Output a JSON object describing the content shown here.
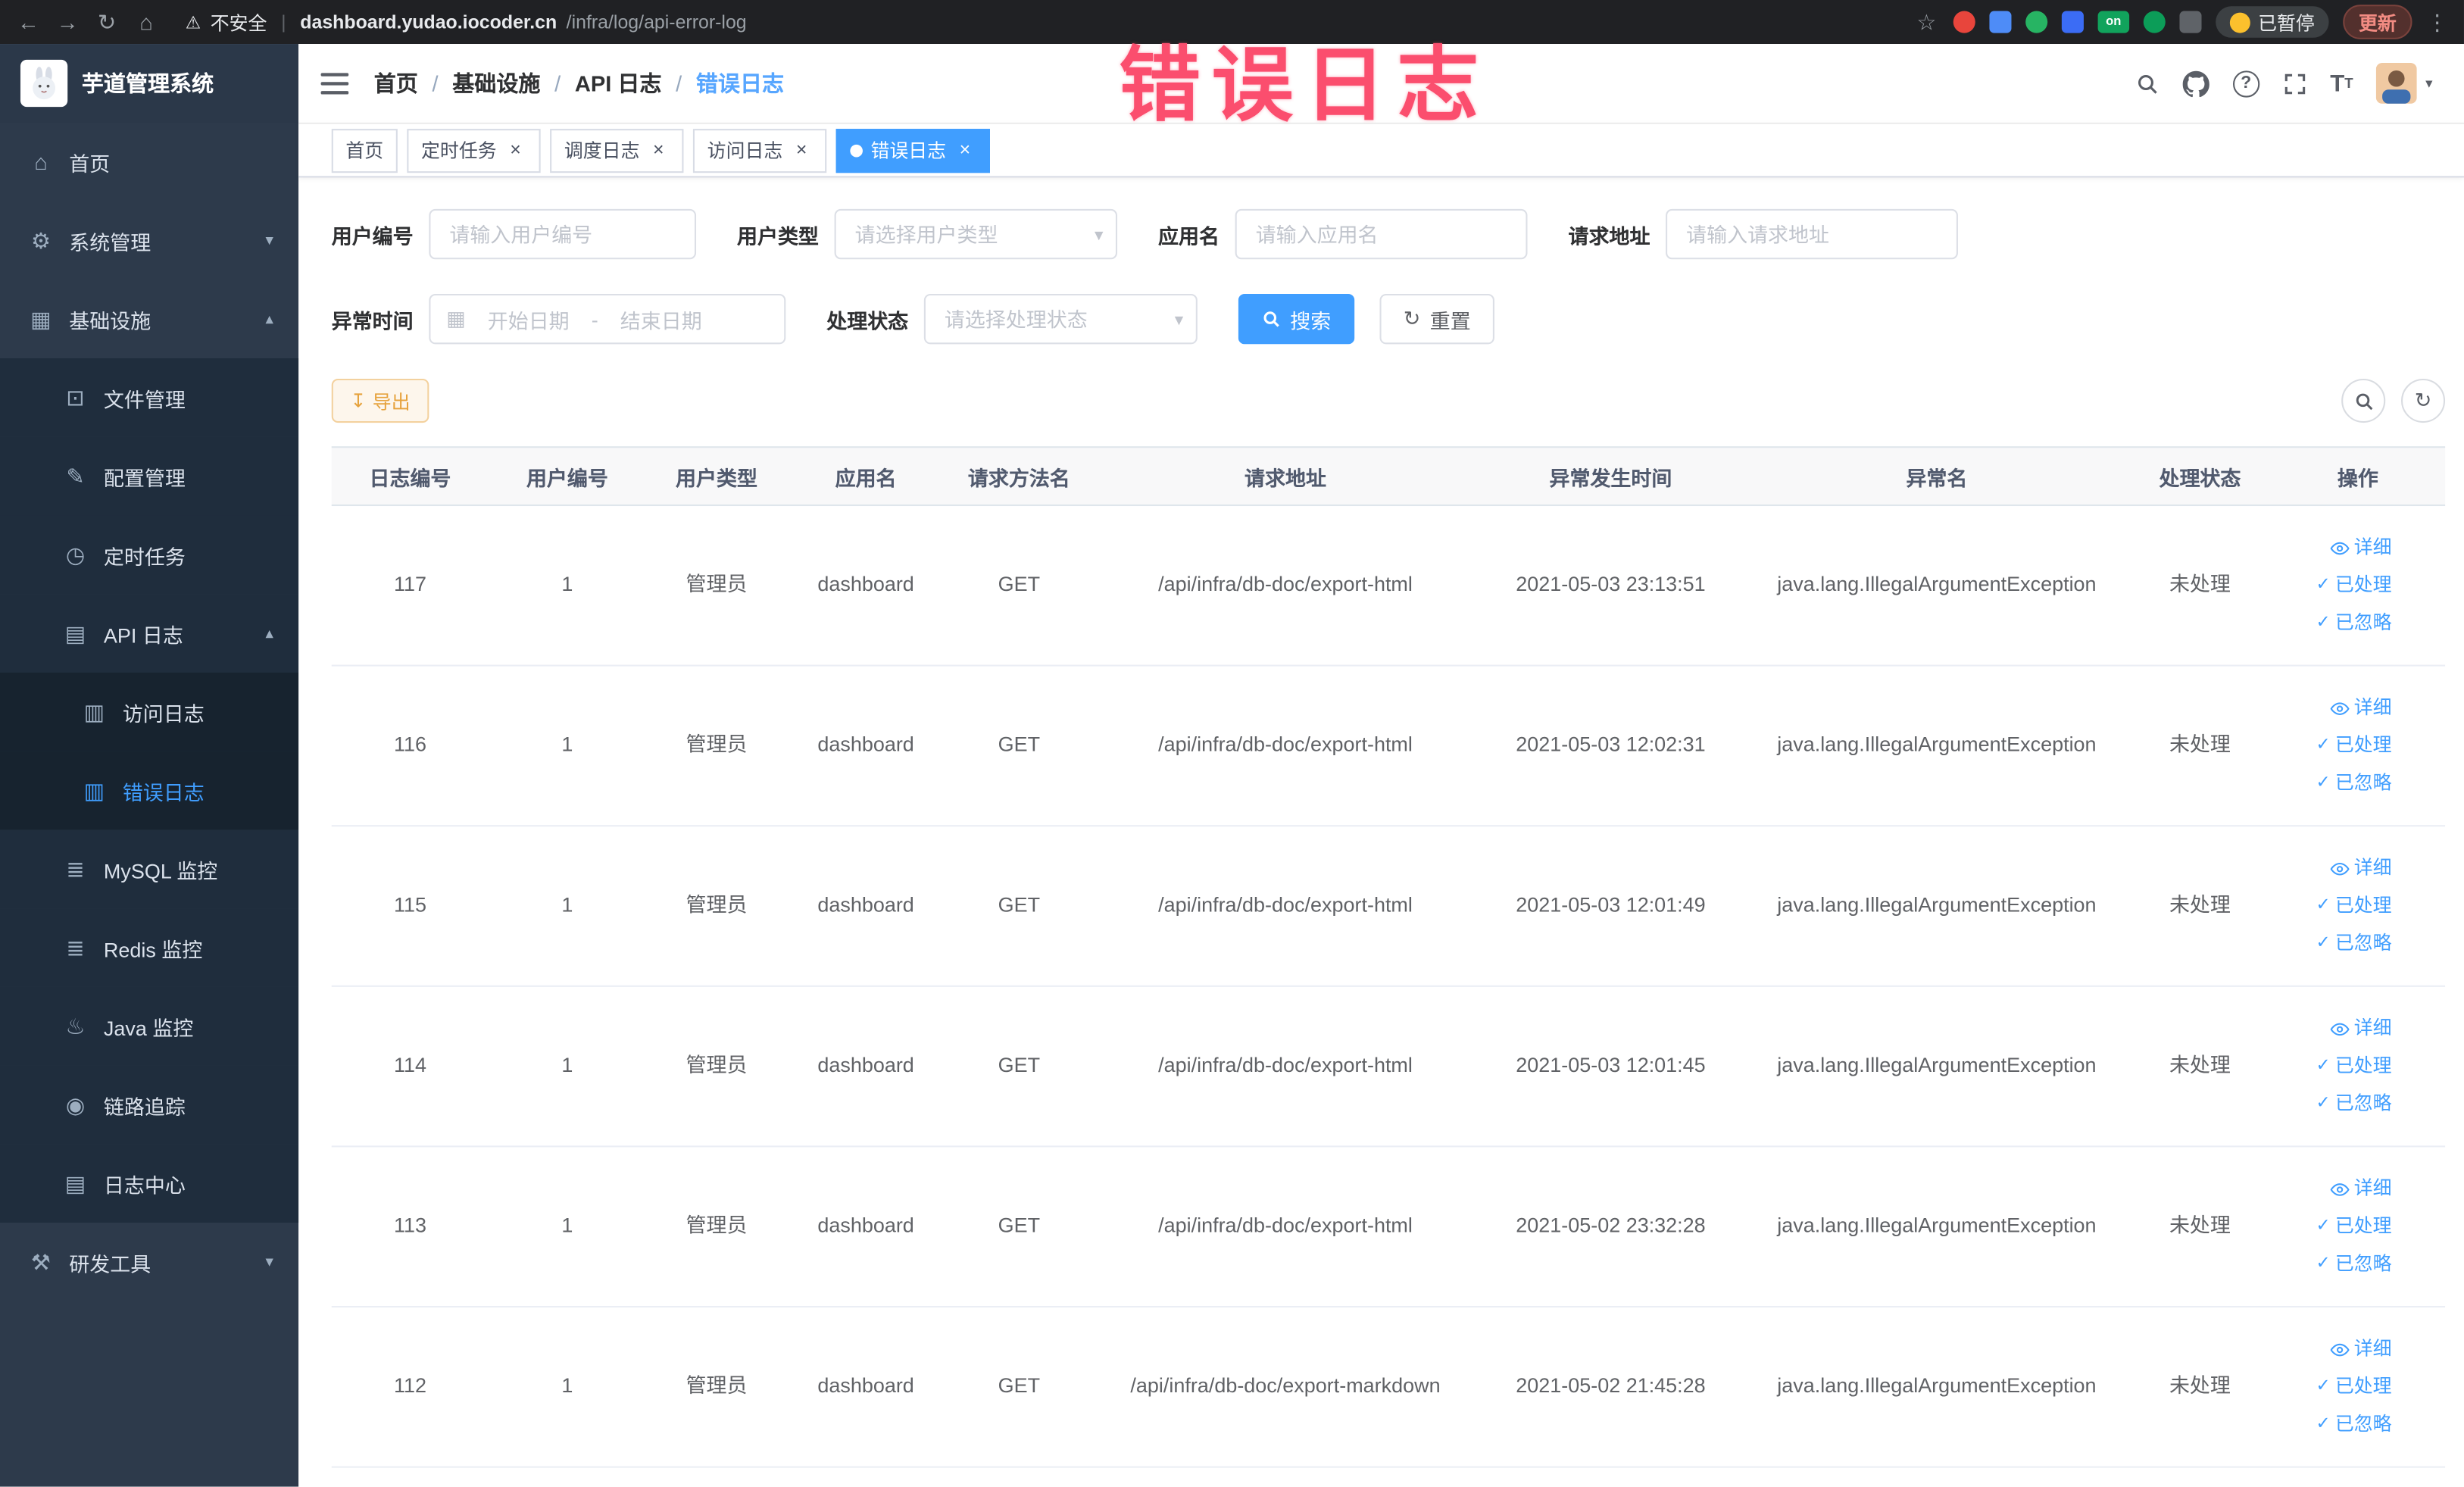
{
  "colors": {
    "accent": "#409eff",
    "warning": "#e6a23c",
    "annotation_pink": "#fb4e6e",
    "sidebar_bg": "#2d3a4b",
    "active_tag_bg": "#409eff"
  },
  "annotation": "错误日志",
  "browser": {
    "security_label": "不安全",
    "url_divider": "|",
    "url_host": "dashboard.yudao.iocoder.cn",
    "url_path": "/infra/log/api-error-log",
    "extension_on_label": "on",
    "paused_label": "已暂停",
    "update_label": "更新"
  },
  "sidebar": {
    "logo_title": "芋道管理系统",
    "items": [
      {
        "name": "home",
        "icon": "home",
        "label": "首页",
        "level": 1
      },
      {
        "name": "system-management",
        "icon": "gear",
        "label": "系统管理",
        "level": 1,
        "chevron": "down"
      },
      {
        "name": "infrastructure",
        "icon": "infra",
        "label": "基础设施",
        "level": 1,
        "chevron": "up"
      },
      {
        "name": "file-management",
        "icon": "file",
        "label": "文件管理",
        "level": 2
      },
      {
        "name": "config-management",
        "icon": "config",
        "label": "配置管理",
        "level": 2
      },
      {
        "name": "scheduled-jobs",
        "icon": "timer",
        "label": "定时任务",
        "level": 2
      },
      {
        "name": "api-log",
        "icon": "api",
        "label": "API 日志",
        "level": 2,
        "chevron": "up"
      },
      {
        "name": "access-log",
        "icon": "doc",
        "label": "访问日志",
        "level": 3
      },
      {
        "name": "error-log",
        "icon": "doc",
        "label": "错误日志",
        "level": 3,
        "active": true
      },
      {
        "name": "mysql-monitor",
        "icon": "db",
        "label": "MySQL 监控",
        "level": 2
      },
      {
        "name": "redis-monitor",
        "icon": "db",
        "label": "Redis 监控",
        "level": 2
      },
      {
        "name": "java-monitor",
        "icon": "java",
        "label": "Java 监控",
        "level": 2
      },
      {
        "name": "trace",
        "icon": "eye",
        "label": "链路追踪",
        "level": 2
      },
      {
        "name": "log-center",
        "icon": "api",
        "label": "日志中心",
        "level": 2
      },
      {
        "name": "dev-tools",
        "icon": "tool",
        "label": "研发工具",
        "level": 1,
        "chevron": "down"
      }
    ]
  },
  "header": {
    "breadcrumb": [
      "首页",
      "基础设施",
      "API 日志",
      "错误日志"
    ],
    "separator": "/"
  },
  "tags": [
    {
      "label": "首页",
      "closable": false,
      "active": false
    },
    {
      "label": "定时任务",
      "closable": true,
      "active": false
    },
    {
      "label": "调度日志",
      "closable": true,
      "active": false
    },
    {
      "label": "访问日志",
      "closable": true,
      "active": false
    },
    {
      "label": "错误日志",
      "closable": true,
      "active": true
    }
  ],
  "filters": {
    "fields": [
      {
        "label": "用户编号",
        "placeholder": "请输入用户编号"
      },
      {
        "label": "用户类型",
        "placeholder": "请选择用户类型"
      },
      {
        "label": "应用名",
        "placeholder": "请输入应用名"
      },
      {
        "label": "请求地址",
        "placeholder": "请输入请求地址"
      },
      {
        "label": "异常时间",
        "start_placeholder": "开始日期",
        "end_placeholder": "结束日期",
        "separator": "-"
      },
      {
        "label": "处理状态",
        "placeholder": "请选择处理状态"
      }
    ],
    "search_label": "搜索",
    "reset_label": "重置"
  },
  "toolbar": {
    "export_label": "导出"
  },
  "table": {
    "columns": [
      "日志编号",
      "用户编号",
      "用户类型",
      "应用名",
      "请求方法名",
      "请求地址",
      "异常发生时间",
      "异常名",
      "处理状态",
      "操作"
    ],
    "actions": {
      "detail": "详细",
      "processed": "已处理",
      "ignored": "已忽略"
    },
    "rows": [
      {
        "id": "117",
        "user_id": "1",
        "user_type": "管理员",
        "app_name": "dashboard",
        "method": "GET",
        "url": "/api/infra/db-doc/export-html",
        "time": "2021-05-03 23:13:51",
        "exception": "java.lang.IllegalArgumentException",
        "status": "未处理"
      },
      {
        "id": "116",
        "user_id": "1",
        "user_type": "管理员",
        "app_name": "dashboard",
        "method": "GET",
        "url": "/api/infra/db-doc/export-html",
        "time": "2021-05-03 12:02:31",
        "exception": "java.lang.IllegalArgumentException",
        "status": "未处理"
      },
      {
        "id": "115",
        "user_id": "1",
        "user_type": "管理员",
        "app_name": "dashboard",
        "method": "GET",
        "url": "/api/infra/db-doc/export-html",
        "time": "2021-05-03 12:01:49",
        "exception": "java.lang.IllegalArgumentException",
        "status": "未处理"
      },
      {
        "id": "114",
        "user_id": "1",
        "user_type": "管理员",
        "app_name": "dashboard",
        "method": "GET",
        "url": "/api/infra/db-doc/export-html",
        "time": "2021-05-03 12:01:45",
        "exception": "java.lang.IllegalArgumentException",
        "status": "未处理"
      },
      {
        "id": "113",
        "user_id": "1",
        "user_type": "管理员",
        "app_name": "dashboard",
        "method": "GET",
        "url": "/api/infra/db-doc/export-html",
        "time": "2021-05-02 23:32:28",
        "exception": "java.lang.IllegalArgumentException",
        "status": "未处理"
      },
      {
        "id": "112",
        "user_id": "1",
        "user_type": "管理员",
        "app_name": "dashboard",
        "method": "GET",
        "url": "/api/infra/db-doc/export-markdown",
        "time": "2021-05-02 21:45:28",
        "exception": "java.lang.IllegalArgumentException",
        "status": "未处理"
      }
    ]
  }
}
